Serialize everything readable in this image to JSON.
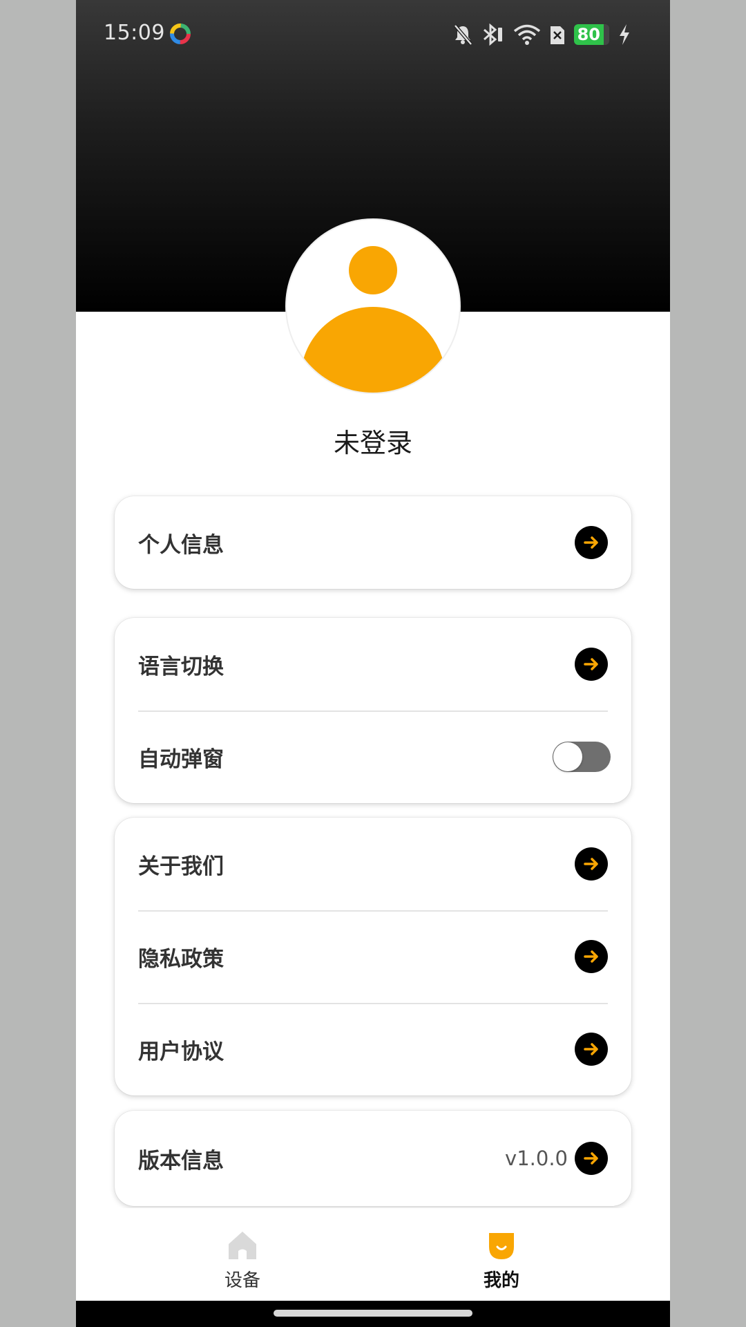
{
  "status_bar": {
    "time": "15:09",
    "battery_level": "80",
    "icons": [
      "app-dot-icon",
      "mute-icon",
      "bluetooth-icon",
      "wifi-icon",
      "sim-icon",
      "battery-icon",
      "charging-icon"
    ]
  },
  "profile": {
    "name": "未登录",
    "avatar_color": "#f9a603"
  },
  "cards": {
    "personal": {
      "label": "个人信息"
    },
    "language": {
      "label": "语言切换"
    },
    "auto_popup": {
      "label": "自动弹窗",
      "enabled": false
    },
    "about": {
      "label": "关于我们"
    },
    "privacy": {
      "label": "隐私政策"
    },
    "agreement": {
      "label": "用户协议"
    },
    "version": {
      "label": "版本信息",
      "value": "v1.0.0"
    }
  },
  "bottom_nav": {
    "devices_label": "设备",
    "mine_label": "我的",
    "active_tab": "我的"
  },
  "colors": {
    "accent": "#f9a603",
    "header_dark": "#000000",
    "arrow_button": "#000000"
  }
}
